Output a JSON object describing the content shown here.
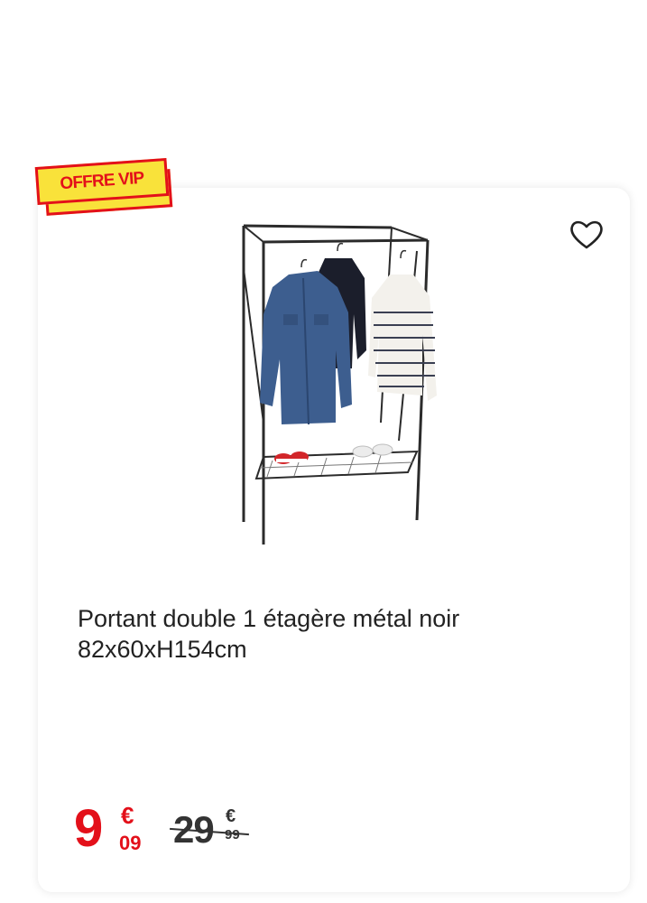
{
  "badge": {
    "label": "OFFRE VIP"
  },
  "colors": {
    "accent_red": "#e3101a",
    "badge_yellow": "#f9e23a",
    "text": "#222222"
  },
  "favorite": {
    "icon": "heart-outline-icon"
  },
  "product": {
    "image_icon": "clothing-rack-image",
    "title_line1": "Portant double 1 étagère métal noir",
    "title_line2": "82x60xH154cm"
  },
  "price": {
    "current_int": "9",
    "current_currency": "€",
    "current_dec": "09",
    "old_int": "29",
    "old_currency": "€",
    "old_dec": "99"
  }
}
